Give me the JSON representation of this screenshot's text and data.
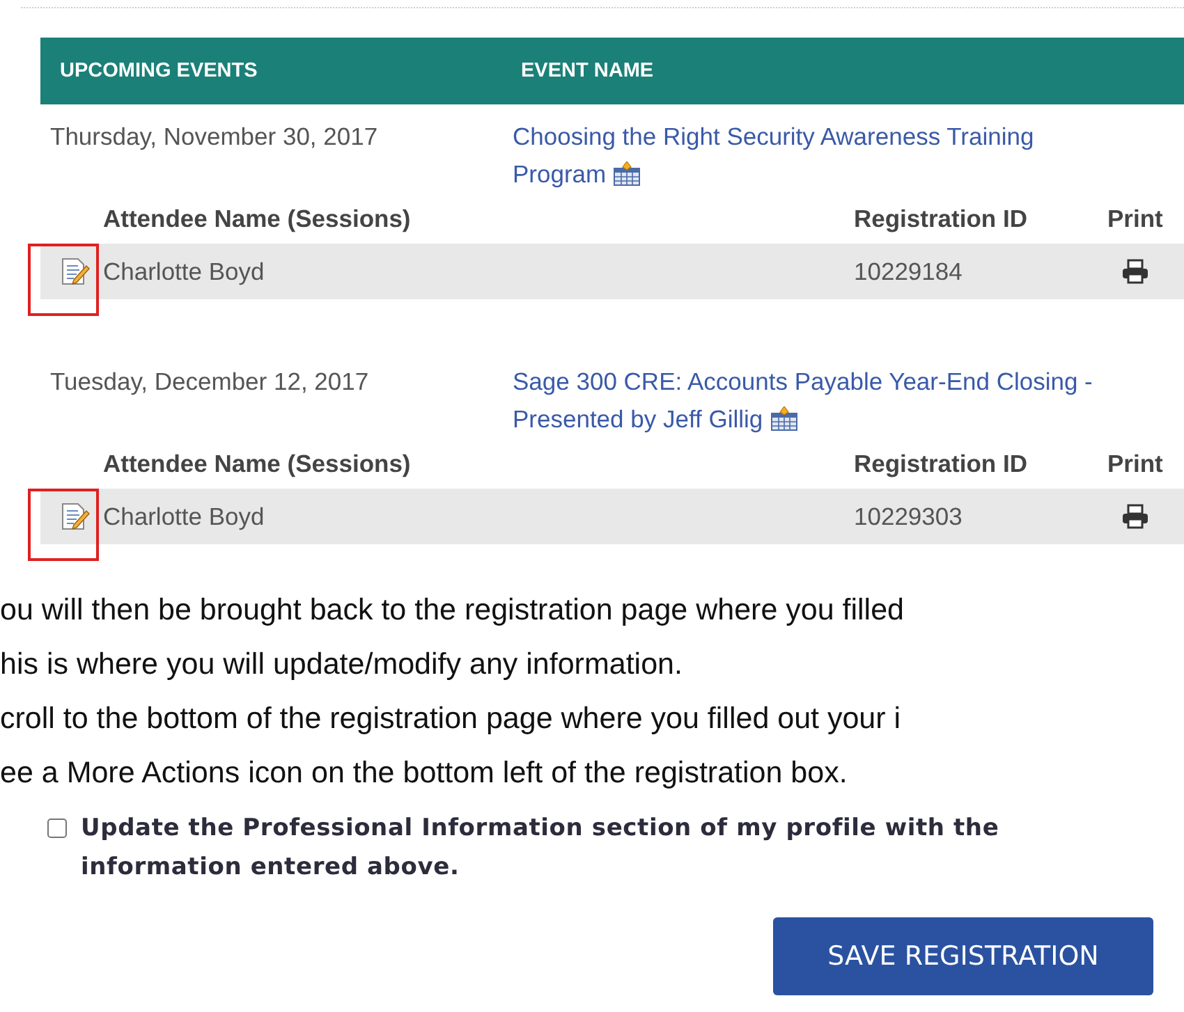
{
  "table": {
    "columns": [
      "UPCOMING EVENTS",
      "EVENT NAME"
    ],
    "events": [
      {
        "date": "Thursday, November 30, 2017",
        "name": "Choosing the Right Security Awareness Training Program",
        "subcolumns": [
          "Attendee Name (Sessions)",
          "Registration ID",
          "Print"
        ],
        "attendee": "Charlotte Boyd",
        "registration_id": "10229184",
        "highlighted": true
      },
      {
        "date": "Tuesday, December 12, 2017",
        "name": "Sage 300 CRE: Accounts Payable Year-End Closing - Presented by Jeff Gillig",
        "subcolumns": [
          "Attendee Name (Sessions)",
          "Registration ID",
          "Print"
        ],
        "attendee": "Charlotte Boyd",
        "registration_id": "10229303",
        "highlighted": true
      }
    ]
  },
  "instructions": [
    "ou will then be brought back to the registration page where you filled",
    "his is where you will update/modify any information.",
    "croll to the bottom of the registration page where you filled out your i",
    "ee a More Actions icon on the bottom left of the registration box."
  ],
  "profile_update": {
    "label": "Update the Professional Information section of my profile with the information entered above.",
    "checked": false
  },
  "save_button": "SAVE REGISTRATION"
}
